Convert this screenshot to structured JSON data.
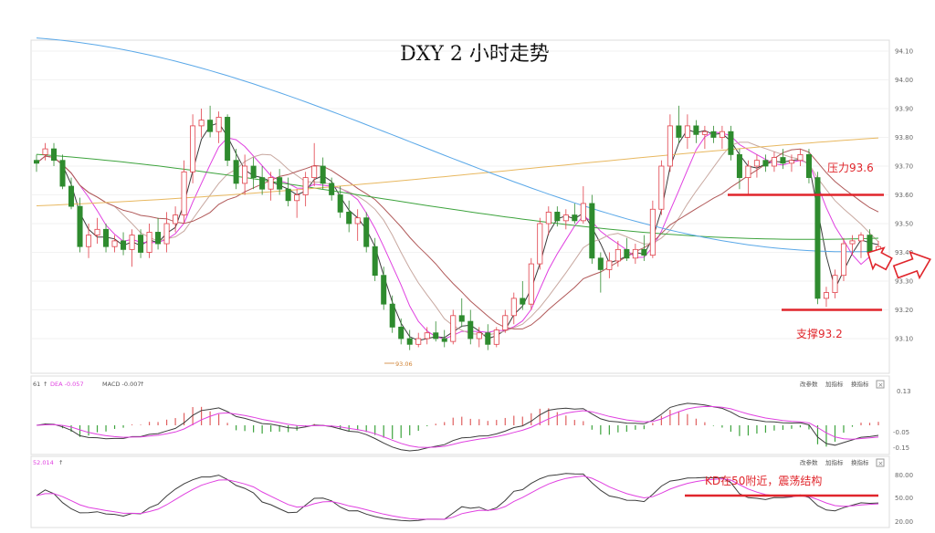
{
  "chart_data": {
    "type": "candlestick",
    "title": "DXY 2 小时走势",
    "main": {
      "yticks": [
        "94.10",
        "94.00",
        "93.90",
        "93.80",
        "93.70",
        "93.60",
        "93.50",
        "93.40",
        "93.30",
        "93.20",
        "93.10"
      ],
      "ylim": [
        93.0,
        94.15
      ],
      "low_label": "93.06",
      "candles": [
        [
          93.72,
          93.74,
          93.68,
          93.71
        ],
        [
          93.74,
          93.78,
          93.72,
          93.76
        ],
        [
          93.76,
          93.78,
          93.7,
          93.72
        ],
        [
          93.72,
          93.74,
          93.62,
          93.63
        ],
        [
          93.63,
          93.66,
          93.55,
          93.56
        ],
        [
          93.56,
          93.59,
          93.4,
          93.42
        ],
        [
          93.42,
          93.5,
          93.38,
          93.46
        ],
        [
          93.46,
          93.52,
          93.43,
          93.48
        ],
        [
          93.48,
          93.5,
          93.4,
          93.42
        ],
        [
          93.42,
          93.46,
          93.4,
          93.44
        ],
        [
          93.44,
          93.47,
          93.39,
          93.41
        ],
        [
          93.41,
          93.48,
          93.35,
          93.46
        ],
        [
          93.46,
          93.48,
          93.38,
          93.4
        ],
        [
          93.4,
          93.5,
          93.38,
          93.47
        ],
        [
          93.47,
          93.52,
          93.41,
          93.43
        ],
        [
          93.43,
          93.54,
          93.4,
          93.5
        ],
        [
          93.5,
          93.56,
          93.47,
          93.53
        ],
        [
          93.53,
          93.72,
          93.5,
          93.68
        ],
        [
          93.68,
          93.88,
          93.64,
          93.84
        ],
        [
          93.84,
          93.9,
          93.8,
          93.86
        ],
        [
          93.86,
          93.91,
          93.8,
          93.82
        ],
        [
          93.82,
          93.89,
          93.78,
          93.87
        ],
        [
          93.87,
          93.88,
          93.7,
          93.72
        ],
        [
          93.72,
          93.76,
          93.62,
          93.64
        ],
        [
          93.64,
          93.74,
          93.6,
          93.7
        ],
        [
          93.7,
          93.73,
          93.62,
          93.66
        ],
        [
          93.66,
          93.7,
          93.6,
          93.62
        ],
        [
          93.62,
          93.68,
          93.58,
          93.66
        ],
        [
          93.66,
          93.69,
          93.6,
          93.62
        ],
        [
          93.62,
          93.66,
          93.56,
          93.58
        ],
        [
          93.58,
          93.62,
          93.52,
          93.6
        ],
        [
          93.6,
          93.68,
          93.56,
          93.66
        ],
        [
          93.66,
          93.78,
          93.63,
          93.7
        ],
        [
          93.7,
          93.73,
          93.62,
          93.64
        ],
        [
          93.64,
          93.66,
          93.58,
          93.6
        ],
        [
          93.6,
          93.63,
          93.52,
          93.54
        ],
        [
          93.54,
          93.58,
          93.47,
          93.5
        ],
        [
          93.5,
          93.55,
          93.44,
          93.52
        ],
        [
          93.52,
          93.54,
          93.4,
          93.42
        ],
        [
          93.42,
          93.45,
          93.3,
          93.32
        ],
        [
          93.32,
          93.35,
          93.2,
          93.22
        ],
        [
          93.22,
          93.25,
          93.12,
          93.14
        ],
        [
          93.14,
          93.17,
          93.08,
          93.1
        ],
        [
          93.1,
          93.13,
          93.06,
          93.08
        ],
        [
          93.08,
          93.12,
          93.07,
          93.1
        ],
        [
          93.1,
          93.14,
          93.08,
          93.12
        ],
        [
          93.12,
          93.16,
          93.09,
          93.1
        ],
        [
          93.1,
          93.13,
          93.07,
          93.09
        ],
        [
          93.09,
          93.2,
          93.08,
          93.18
        ],
        [
          93.18,
          93.24,
          93.14,
          93.16
        ],
        [
          93.16,
          93.2,
          93.08,
          93.1
        ],
        [
          93.1,
          93.14,
          93.07,
          93.12
        ],
        [
          93.12,
          93.15,
          93.06,
          93.08
        ],
        [
          93.08,
          93.14,
          93.07,
          93.13
        ],
        [
          93.13,
          93.2,
          93.12,
          93.18
        ],
        [
          93.18,
          93.26,
          93.15,
          93.24
        ],
        [
          93.24,
          93.3,
          93.2,
          93.22
        ],
        [
          93.22,
          93.38,
          93.2,
          93.36
        ],
        [
          93.36,
          93.52,
          93.34,
          93.5
        ],
        [
          93.5,
          93.56,
          93.46,
          93.54
        ],
        [
          93.54,
          93.56,
          93.49,
          93.51
        ],
        [
          93.51,
          93.55,
          93.48,
          93.53
        ],
        [
          93.53,
          93.57,
          93.5,
          93.51
        ],
        [
          93.51,
          93.63,
          93.5,
          93.57
        ],
        [
          93.57,
          93.6,
          93.36,
          93.38
        ],
        [
          93.38,
          93.4,
          93.26,
          93.34
        ],
        [
          93.34,
          93.4,
          93.31,
          93.37
        ],
        [
          93.37,
          93.44,
          93.35,
          93.41
        ],
        [
          93.41,
          93.45,
          93.37,
          93.38
        ],
        [
          93.38,
          93.43,
          93.36,
          93.41
        ],
        [
          93.41,
          93.46,
          93.37,
          93.39
        ],
        [
          93.39,
          93.58,
          93.38,
          93.55
        ],
        [
          93.55,
          93.72,
          93.53,
          93.7
        ],
        [
          93.7,
          93.88,
          93.68,
          93.84
        ],
        [
          93.84,
          93.91,
          93.78,
          93.8
        ],
        [
          93.8,
          93.88,
          93.76,
          93.84
        ],
        [
          93.84,
          93.86,
          93.78,
          93.81
        ],
        [
          93.81,
          93.84,
          93.76,
          93.82
        ],
        [
          93.82,
          93.84,
          93.78,
          93.8
        ],
        [
          93.8,
          93.84,
          93.76,
          93.82
        ],
        [
          93.82,
          93.84,
          93.72,
          93.74
        ],
        [
          93.74,
          93.76,
          93.62,
          93.66
        ],
        [
          93.66,
          93.72,
          93.6,
          93.7
        ],
        [
          93.7,
          93.74,
          93.66,
          93.72
        ],
        [
          93.72,
          93.74,
          93.68,
          93.7
        ],
        [
          93.7,
          93.75,
          93.68,
          93.73
        ],
        [
          93.73,
          93.76,
          93.69,
          93.71
        ],
        [
          93.71,
          93.74,
          93.68,
          93.72
        ],
        [
          93.72,
          93.76,
          93.7,
          93.74
        ],
        [
          93.74,
          93.76,
          93.64,
          93.66
        ],
        [
          93.66,
          93.68,
          93.22,
          93.24
        ],
        [
          93.24,
          93.28,
          93.21,
          93.26
        ],
        [
          93.26,
          93.34,
          93.24,
          93.32
        ],
        [
          93.32,
          93.45,
          93.3,
          93.43
        ],
        [
          93.43,
          93.46,
          93.39,
          93.44
        ],
        [
          93.44,
          93.47,
          93.38,
          93.46
        ],
        [
          93.46,
          93.48,
          93.38,
          93.4
        ],
        [
          93.4,
          93.44,
          93.38,
          93.42
        ]
      ],
      "moving_averages": [
        {
          "color": "#3c3c3c",
          "period": 5
        },
        {
          "color": "#e040e0",
          "period": 10
        },
        {
          "color": "#c8a8a0",
          "period": 20
        },
        {
          "color": "#b05858",
          "period": 30
        },
        {
          "color": "#3da33d",
          "period": 60
        },
        {
          "color": "#e8b860",
          "period": 120
        },
        {
          "color": "#5aa8e8",
          "period": 250
        }
      ]
    },
    "macd_panel": {
      "legend_prefix": "61",
      "legend_items": [
        "DEA -0.057",
        "MACD -0.007"
      ],
      "buttons": [
        "改参数",
        "加指标",
        "换指标"
      ],
      "yticks": [
        "0.13",
        "-0.05",
        "-0.15"
      ]
    },
    "kd_panel": {
      "legend_value": "52.014",
      "yticks": [
        "80.00",
        "50.00",
        "20.00"
      ]
    },
    "annotations": {
      "resistance_label": "压力93.6",
      "resistance_level": 93.6,
      "support_label": "支撑93.2",
      "support_level": 93.2,
      "kd_note": "KD在50附近，震荡结构",
      "kd_level": 50
    },
    "colors": {
      "up": "#e0404a",
      "down": "#2e8b2e",
      "annotation": "#e0252b"
    }
  }
}
